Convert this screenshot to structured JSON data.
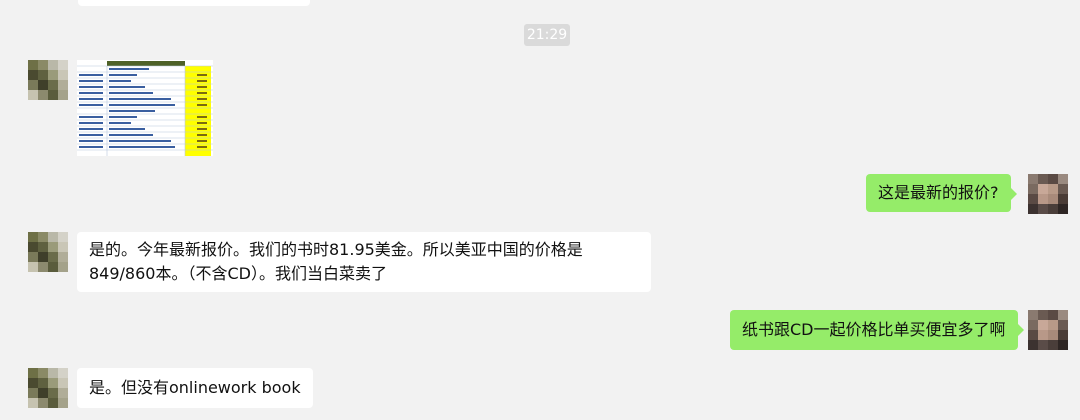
{
  "chat": {
    "timestamp": "21:29",
    "messages": [
      {
        "side": "left",
        "type": "image",
        "content": "spreadsheet-screenshot"
      },
      {
        "side": "right",
        "type": "text",
        "text": "这是最新的报价?"
      },
      {
        "side": "left",
        "type": "text",
        "text": "是的。今年最新报价。我们的书时81.95美金。所以美亚中国的价格是849/860本。（不含CD）。我们当白菜卖了"
      },
      {
        "side": "right",
        "type": "text",
        "text": "纸书跟CD一起价格比单买便宜多了啊"
      },
      {
        "side": "left",
        "type": "text",
        "text": "是。但没有onlinework book"
      }
    ]
  },
  "colors": {
    "background": "#f2f2f2",
    "outgoing_bubble": "#95ec69",
    "incoming_bubble": "#ffffff",
    "timestamp_bg": "#dadada"
  }
}
